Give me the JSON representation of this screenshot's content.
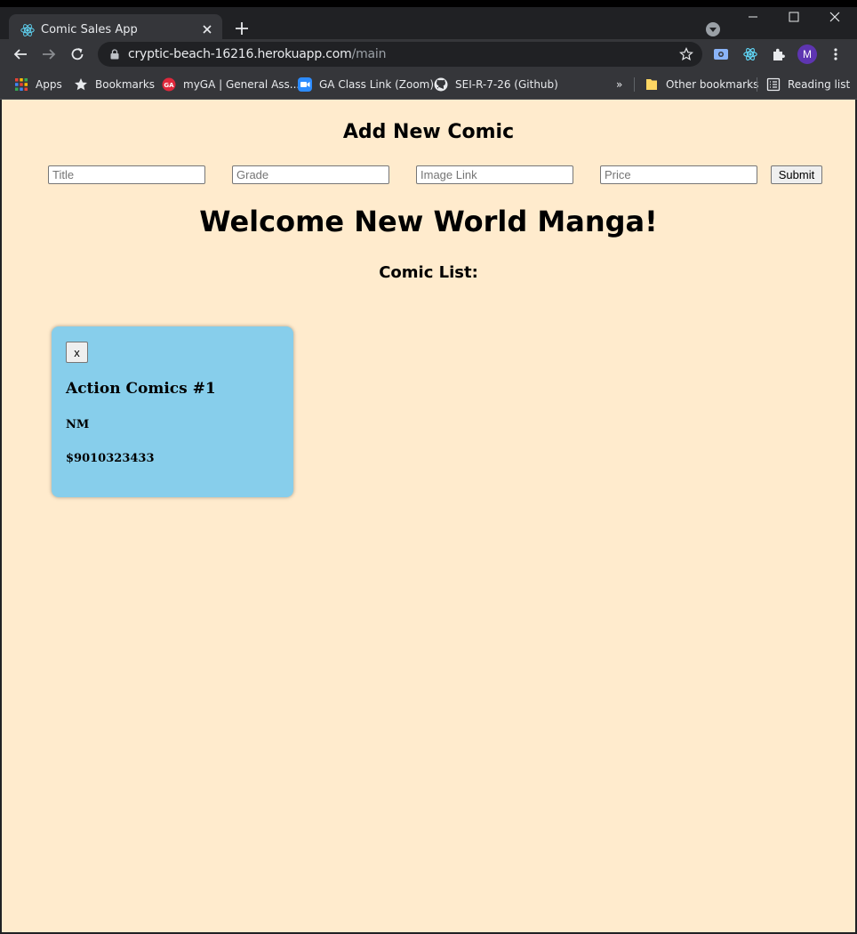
{
  "browser": {
    "tab_title": "Comic Sales App",
    "url_host": "cryptic-beach-16216.herokuapp.com",
    "url_path": "/main",
    "avatar_initial": "M",
    "bookmarks": [
      {
        "label": "Apps",
        "icon": "apps-grid-icon"
      },
      {
        "label": "Bookmarks",
        "icon": "star-icon"
      },
      {
        "label": "myGA | General Ass...",
        "icon": "ga-logo-icon"
      },
      {
        "label": "GA Class Link (Zoom)",
        "icon": "zoom-icon"
      },
      {
        "label": "SEI-R-7-26 (Github)",
        "icon": "github-icon"
      }
    ],
    "bookmarks_overflow": "»",
    "other_bookmarks": "Other bookmarks",
    "reading_list": "Reading list"
  },
  "form": {
    "heading": "Add New Comic",
    "title_placeholder": "Title",
    "grade_placeholder": "Grade",
    "image_placeholder": "Image Link",
    "price_placeholder": "Price",
    "submit_label": "Submit"
  },
  "welcome": "Welcome New World Manga!",
  "list_heading": "Comic List:",
  "comics": [
    {
      "delete_label": "x",
      "title": "Action Comics #1",
      "grade": "NM",
      "price": "$9010323433"
    }
  ],
  "colors": {
    "page_background": "#ffebcd",
    "card_background": "#87ceeb",
    "chrome_dark": "#202124",
    "chrome_toolbar": "#35363a"
  }
}
